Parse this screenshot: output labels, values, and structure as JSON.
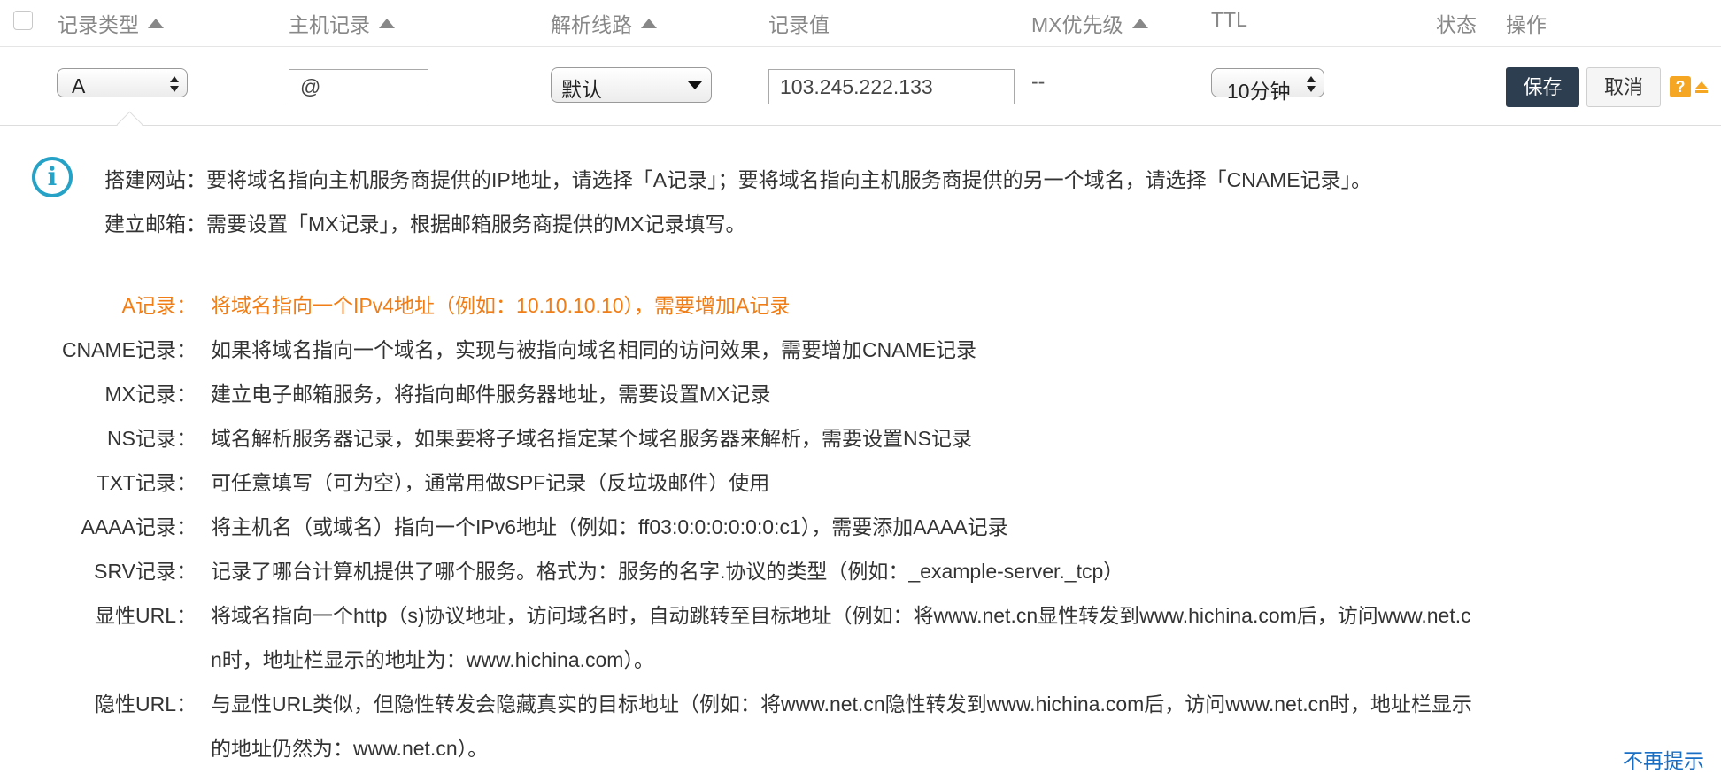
{
  "header": {
    "columns": [
      {
        "label": "记录类型",
        "sortable": true
      },
      {
        "label": "主机记录",
        "sortable": true
      },
      {
        "label": "解析线路",
        "sortable": true
      },
      {
        "label": "记录值",
        "sortable": false
      },
      {
        "label": "MX优先级",
        "sortable": true
      },
      {
        "label": "TTL",
        "sortable": false
      },
      {
        "label": "状态",
        "sortable": false
      },
      {
        "label": "操作",
        "sortable": false
      }
    ]
  },
  "edit_row": {
    "record_type": "A",
    "host": "@",
    "line": "默认",
    "value": "103.245.222.133",
    "mx_priority": "--",
    "ttl": "10分钟",
    "save_label": "保存",
    "cancel_label": "取消",
    "help_label": "?"
  },
  "info": {
    "icon": "info-icon",
    "lines": [
      {
        "label": "搭建网站：",
        "text": "要将域名指向主机服务商提供的IP地址，请选择「A记录」；要将域名指向主机服务商提供的另一个域名，请选择「CNAME记录」。"
      },
      {
        "label": "建立邮箱：",
        "text": "需要设置「MX记录」，根据邮箱服务商提供的MX记录填写。"
      }
    ]
  },
  "definitions": [
    {
      "label": "A记录：",
      "text": "将域名指向一个IPv4地址（例如：10.10.10.10），需要增加A记录",
      "highlight": true
    },
    {
      "label": "CNAME记录：",
      "text": "如果将域名指向一个域名，实现与被指向域名相同的访问效果，需要增加CNAME记录",
      "highlight": false
    },
    {
      "label": "MX记录：",
      "text": "建立电子邮箱服务，将指向邮件服务器地址，需要设置MX记录",
      "highlight": false
    },
    {
      "label": "NS记录：",
      "text": "域名解析服务器记录，如果要将子域名指定某个域名服务器来解析，需要设置NS记录",
      "highlight": false
    },
    {
      "label": "TXT记录：",
      "text": "可任意填写（可为空），通常用做SPF记录（反垃圾邮件）使用",
      "highlight": false
    },
    {
      "label": "AAAA记录：",
      "text": "将主机名（或域名）指向一个IPv6地址（例如：ff03:0:0:0:0:0:0:c1），需要添加AAAA记录",
      "highlight": false
    },
    {
      "label": "SRV记录：",
      "text": "记录了哪台计算机提供了哪个服务。格式为：服务的名字.协议的类型（例如：_example-server._tcp）",
      "highlight": false
    },
    {
      "label": "显性URL：",
      "text": "将域名指向一个http（s)协议地址，访问域名时，自动跳转至目标地址（例如：将www.net.cn显性转发到www.hichina.com后，访问www.net.c",
      "text2": "n时，地址栏显示的地址为：www.hichina.com）。",
      "highlight": false
    },
    {
      "label": "隐性URL：",
      "text": "与显性URL类似，但隐性转发会隐藏真实的目标地址（例如：将www.net.cn隐性转发到www.hichina.com后，访问www.net.cn时，地址栏显示",
      "text2": "的地址仍然为：www.net.cn）。",
      "highlight": false
    }
  ],
  "footer_link": "不再提示",
  "colors": {
    "accent": "#f07d16",
    "info": "#27a2c7",
    "save": "#2d3e50",
    "help": "#f5a623",
    "link": "#1a6fc4"
  }
}
